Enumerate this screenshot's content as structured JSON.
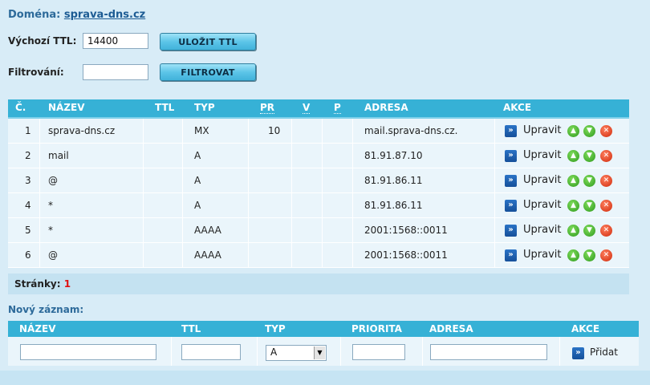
{
  "domain": {
    "label": "Doména:",
    "name": "sprava-dns.cz"
  },
  "ttl_form": {
    "label": "Výchozí TTL:",
    "value": "14400",
    "button": "ULOŽIT TTL"
  },
  "filter_form": {
    "label": "Filtrování:",
    "value": "",
    "button": "FILTROVAT"
  },
  "records_table": {
    "headers": {
      "num": "Č.",
      "name": "NÁZEV",
      "ttl": "TTL",
      "type": "TYP",
      "pr": "PR",
      "v": "V",
      "p": "P",
      "address": "ADRESA",
      "actions": "AKCE"
    },
    "rows": [
      {
        "num": "1",
        "name": "sprava-dns.cz",
        "ttl": "",
        "type": "MX",
        "pr": "10",
        "v": "",
        "p": "",
        "address": "mail.sprava-dns.cz.",
        "edit": "Upravit"
      },
      {
        "num": "2",
        "name": "mail",
        "ttl": "",
        "type": "A",
        "pr": "",
        "v": "",
        "p": "",
        "address": "81.91.87.10",
        "edit": "Upravit"
      },
      {
        "num": "3",
        "name": "@",
        "ttl": "",
        "type": "A",
        "pr": "",
        "v": "",
        "p": "",
        "address": "81.91.86.11",
        "edit": "Upravit"
      },
      {
        "num": "4",
        "name": "*",
        "ttl": "",
        "type": "A",
        "pr": "",
        "v": "",
        "p": "",
        "address": "81.91.86.11",
        "edit": "Upravit"
      },
      {
        "num": "5",
        "name": "*",
        "ttl": "",
        "type": "AAAA",
        "pr": "",
        "v": "",
        "p": "",
        "address": "2001:1568::0011",
        "edit": "Upravit"
      },
      {
        "num": "6",
        "name": "@",
        "ttl": "",
        "type": "AAAA",
        "pr": "",
        "v": "",
        "p": "",
        "address": "2001:1568::0011",
        "edit": "Upravit"
      }
    ]
  },
  "pagination": {
    "label": "Stránky:",
    "current": "1"
  },
  "new_record": {
    "title": "Nový záznam:",
    "headers": {
      "name": "NÁZEV",
      "ttl": "TTL",
      "type": "TYP",
      "priority": "PRIORITA",
      "address": "ADRESA",
      "actions": "AKCE"
    },
    "type_selected": "A",
    "add_button": "Přidat"
  },
  "icons": {
    "edit": "double-chevron-right-icon",
    "move_up": "arrow-up-circle-icon",
    "move_down": "arrow-down-circle-icon",
    "delete": "x-circle-icon"
  },
  "colors": {
    "header": "#36b1d6",
    "accent": "#1d5c94",
    "delete": "#cf2a0b",
    "move": "#2e9a1c"
  }
}
